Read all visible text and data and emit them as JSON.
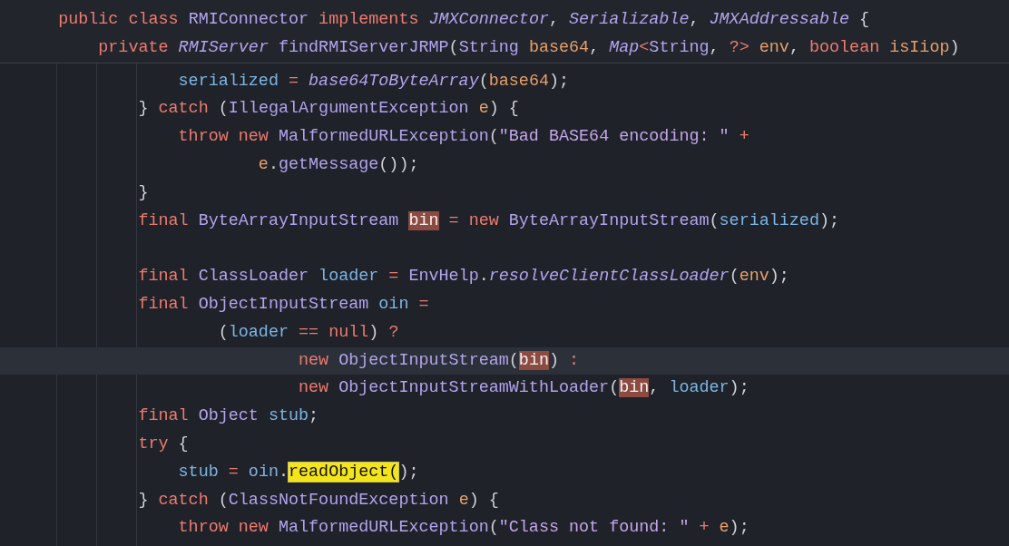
{
  "sticky_header": [
    {
      "tokens": [
        {
          "text": "    public class ",
          "kind": "kw"
        },
        {
          "text": "RMIConnector ",
          "kind": "type"
        },
        {
          "text": "implements ",
          "kind": "kw"
        },
        {
          "text": "JMXConnector",
          "kind": "type_i"
        },
        {
          "text": ", ",
          "kind": "punct"
        },
        {
          "text": "Serializable",
          "kind": "type_i"
        },
        {
          "text": ", ",
          "kind": "punct"
        },
        {
          "text": "JMXAddressable",
          "kind": "type_i"
        },
        {
          "text": " {",
          "kind": "punct"
        }
      ]
    },
    {
      "tokens": [
        {
          "text": "        private ",
          "kind": "kw"
        },
        {
          "text": "RMIServer ",
          "kind": "type_i"
        },
        {
          "text": "findRMIServerJRMP",
          "kind": "type"
        },
        {
          "text": "(",
          "kind": "punct"
        },
        {
          "text": "String ",
          "kind": "type"
        },
        {
          "text": "base64",
          "kind": "param"
        },
        {
          "text": ", ",
          "kind": "punct"
        },
        {
          "text": "Map",
          "kind": "type_i"
        },
        {
          "text": "<",
          "kind": "op"
        },
        {
          "text": "String",
          "kind": "type"
        },
        {
          "text": ", ",
          "kind": "punct"
        },
        {
          "text": "?>",
          "kind": "op"
        },
        {
          "text": " env",
          "kind": "param"
        },
        {
          "text": ", ",
          "kind": "punct"
        },
        {
          "text": "boolean ",
          "kind": "kw"
        },
        {
          "text": "isIiop",
          "kind": "param"
        },
        {
          "text": ")",
          "kind": "punct"
        }
      ]
    }
  ],
  "code_lines": [
    {
      "current": false,
      "tokens": [
        {
          "text": "                serialized ",
          "kind": "var"
        },
        {
          "text": "= ",
          "kind": "op"
        },
        {
          "text": "base64ToByteArray",
          "kind": "type_i"
        },
        {
          "text": "(",
          "kind": "punct"
        },
        {
          "text": "base64",
          "kind": "param"
        },
        {
          "text": ");",
          "kind": "punct"
        }
      ]
    },
    {
      "current": false,
      "tokens": [
        {
          "text": "            } ",
          "kind": "punct"
        },
        {
          "text": "catch ",
          "kind": "kw"
        },
        {
          "text": "(",
          "kind": "punct"
        },
        {
          "text": "IllegalArgumentException ",
          "kind": "type"
        },
        {
          "text": "e",
          "kind": "param"
        },
        {
          "text": ") {",
          "kind": "punct"
        }
      ]
    },
    {
      "current": false,
      "tokens": [
        {
          "text": "                throw new ",
          "kind": "kw"
        },
        {
          "text": "MalformedURLException",
          "kind": "type"
        },
        {
          "text": "(",
          "kind": "punct"
        },
        {
          "text": "\"Bad BASE64 encoding: \"",
          "kind": "str"
        },
        {
          "text": " +",
          "kind": "op"
        }
      ]
    },
    {
      "current": false,
      "tokens": [
        {
          "text": "                        e",
          "kind": "param"
        },
        {
          "text": ".",
          "kind": "punct"
        },
        {
          "text": "getMessage",
          "kind": "type"
        },
        {
          "text": "());",
          "kind": "punct"
        }
      ]
    },
    {
      "current": false,
      "tokens": [
        {
          "text": "            }",
          "kind": "punct"
        }
      ]
    },
    {
      "current": false,
      "tokens": [
        {
          "text": "            final ",
          "kind": "kw"
        },
        {
          "text": "ByteArrayInputStream ",
          "kind": "type"
        },
        {
          "text": "bin",
          "kind": "usage"
        },
        {
          "text": " = ",
          "kind": "op"
        },
        {
          "text": "new ",
          "kind": "kw"
        },
        {
          "text": "ByteArrayInputStream",
          "kind": "type"
        },
        {
          "text": "(",
          "kind": "punct"
        },
        {
          "text": "serialized",
          "kind": "var"
        },
        {
          "text": ");",
          "kind": "punct"
        }
      ]
    },
    {
      "current": false
    },
    {
      "current": false,
      "tokens": [
        {
          "text": "            final ",
          "kind": "kw"
        },
        {
          "text": "ClassLoader ",
          "kind": "type"
        },
        {
          "text": "loader ",
          "kind": "var"
        },
        {
          "text": "= ",
          "kind": "op"
        },
        {
          "text": "EnvHelp",
          "kind": "type"
        },
        {
          "text": ".",
          "kind": "punct"
        },
        {
          "text": "resolveClientClassLoader",
          "kind": "type_i"
        },
        {
          "text": "(",
          "kind": "punct"
        },
        {
          "text": "env",
          "kind": "param"
        },
        {
          "text": ");",
          "kind": "punct"
        }
      ]
    },
    {
      "current": false,
      "tokens": [
        {
          "text": "            final ",
          "kind": "kw"
        },
        {
          "text": "ObjectInputStream ",
          "kind": "type"
        },
        {
          "text": "oin ",
          "kind": "var"
        },
        {
          "text": "=",
          "kind": "op"
        }
      ]
    },
    {
      "current": false,
      "tokens": [
        {
          "text": "                    (",
          "kind": "punct"
        },
        {
          "text": "loader ",
          "kind": "var"
        },
        {
          "text": "== null",
          "kind": "op"
        },
        {
          "text": ") ",
          "kind": "punct"
        },
        {
          "text": "?",
          "kind": "op"
        }
      ]
    },
    {
      "current": true,
      "tokens": [
        {
          "text": "                            new ",
          "kind": "kw"
        },
        {
          "text": "ObjectInputStream",
          "kind": "type"
        },
        {
          "text": "(",
          "kind": "punct"
        },
        {
          "text": "bin",
          "kind": "usage"
        },
        {
          "text": ") ",
          "kind": "punct"
        },
        {
          "text": ":",
          "kind": "op"
        }
      ]
    },
    {
      "current": false,
      "tokens": [
        {
          "text": "                            new ",
          "kind": "kw"
        },
        {
          "text": "ObjectInputStreamWithLoader",
          "kind": "type"
        },
        {
          "text": "(",
          "kind": "punct"
        },
        {
          "text": "bin",
          "kind": "usage"
        },
        {
          "text": ", ",
          "kind": "punct"
        },
        {
          "text": "loader",
          "kind": "var"
        },
        {
          "text": ");",
          "kind": "punct"
        }
      ]
    },
    {
      "current": false,
      "tokens": [
        {
          "text": "            final ",
          "kind": "kw"
        },
        {
          "text": "Object ",
          "kind": "type"
        },
        {
          "text": "stub",
          "kind": "var"
        },
        {
          "text": ";",
          "kind": "punct"
        }
      ]
    },
    {
      "current": false,
      "tokens": [
        {
          "text": "            try",
          "kind": "kw"
        },
        {
          "text": " {",
          "kind": "punct"
        }
      ]
    },
    {
      "current": false,
      "tokens": [
        {
          "text": "                stub ",
          "kind": "var"
        },
        {
          "text": "= ",
          "kind": "op"
        },
        {
          "text": "oin",
          "kind": "var"
        },
        {
          "text": ".",
          "kind": "punct"
        },
        {
          "text": "readObject(",
          "kind": "match"
        },
        {
          "text": ");",
          "kind": "punct"
        }
      ]
    },
    {
      "current": false,
      "tokens": [
        {
          "text": "            } ",
          "kind": "punct"
        },
        {
          "text": "catch ",
          "kind": "kw"
        },
        {
          "text": "(",
          "kind": "punct"
        },
        {
          "text": "ClassNotFoundException ",
          "kind": "type"
        },
        {
          "text": "e",
          "kind": "param"
        },
        {
          "text": ") {",
          "kind": "punct"
        }
      ]
    },
    {
      "current": false,
      "tokens": [
        {
          "text": "                throw new ",
          "kind": "kw"
        },
        {
          "text": "MalformedURLException",
          "kind": "type"
        },
        {
          "text": "(",
          "kind": "punct"
        },
        {
          "text": "\"Class not found: \"",
          "kind": "str"
        },
        {
          "text": " + ",
          "kind": "op"
        },
        {
          "text": "e",
          "kind": "param"
        },
        {
          "text": ");",
          "kind": "punct"
        }
      ]
    }
  ]
}
